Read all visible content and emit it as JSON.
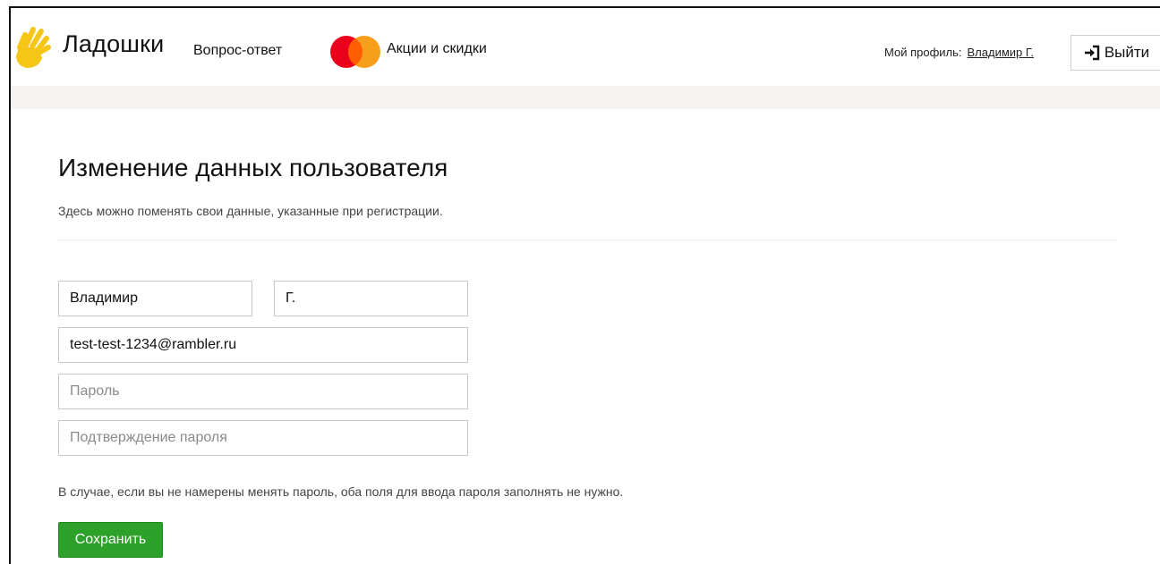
{
  "header": {
    "logo_text": "Ладошки",
    "nav": {
      "qa_label": "Вопрос-ответ",
      "promo_label": "Акции и скидки"
    },
    "profile": {
      "label": "Мой профиль:",
      "user_name": "Владимир Г."
    },
    "logout_label": "Выйти"
  },
  "page": {
    "title": "Изменение данных пользователя",
    "subtitle": "Здесь можно поменять свои данные, указанные при регистрации."
  },
  "form": {
    "first_name": "Владимир",
    "last_name": "Г.",
    "email": "test-test-1234@rambler.ru",
    "password_placeholder": "Пароль",
    "password_confirm_placeholder": "Подтверждение пароля",
    "note": "В случае, если вы не намерены менять пароль, оба поля для ввода пароля заполнять не нужно.",
    "save_label": "Сохранить"
  },
  "icons": {
    "logo": "hand-icon",
    "promo": "mastercard-icon",
    "logout": "sign-in-arrow-icon"
  },
  "colors": {
    "logo_yellow": "#F5C518",
    "mastercard_red": "#EB001B",
    "mastercard_orange": "#F79E1B",
    "save_button": "#2DA12A",
    "header_band": "#F5F4F2"
  }
}
